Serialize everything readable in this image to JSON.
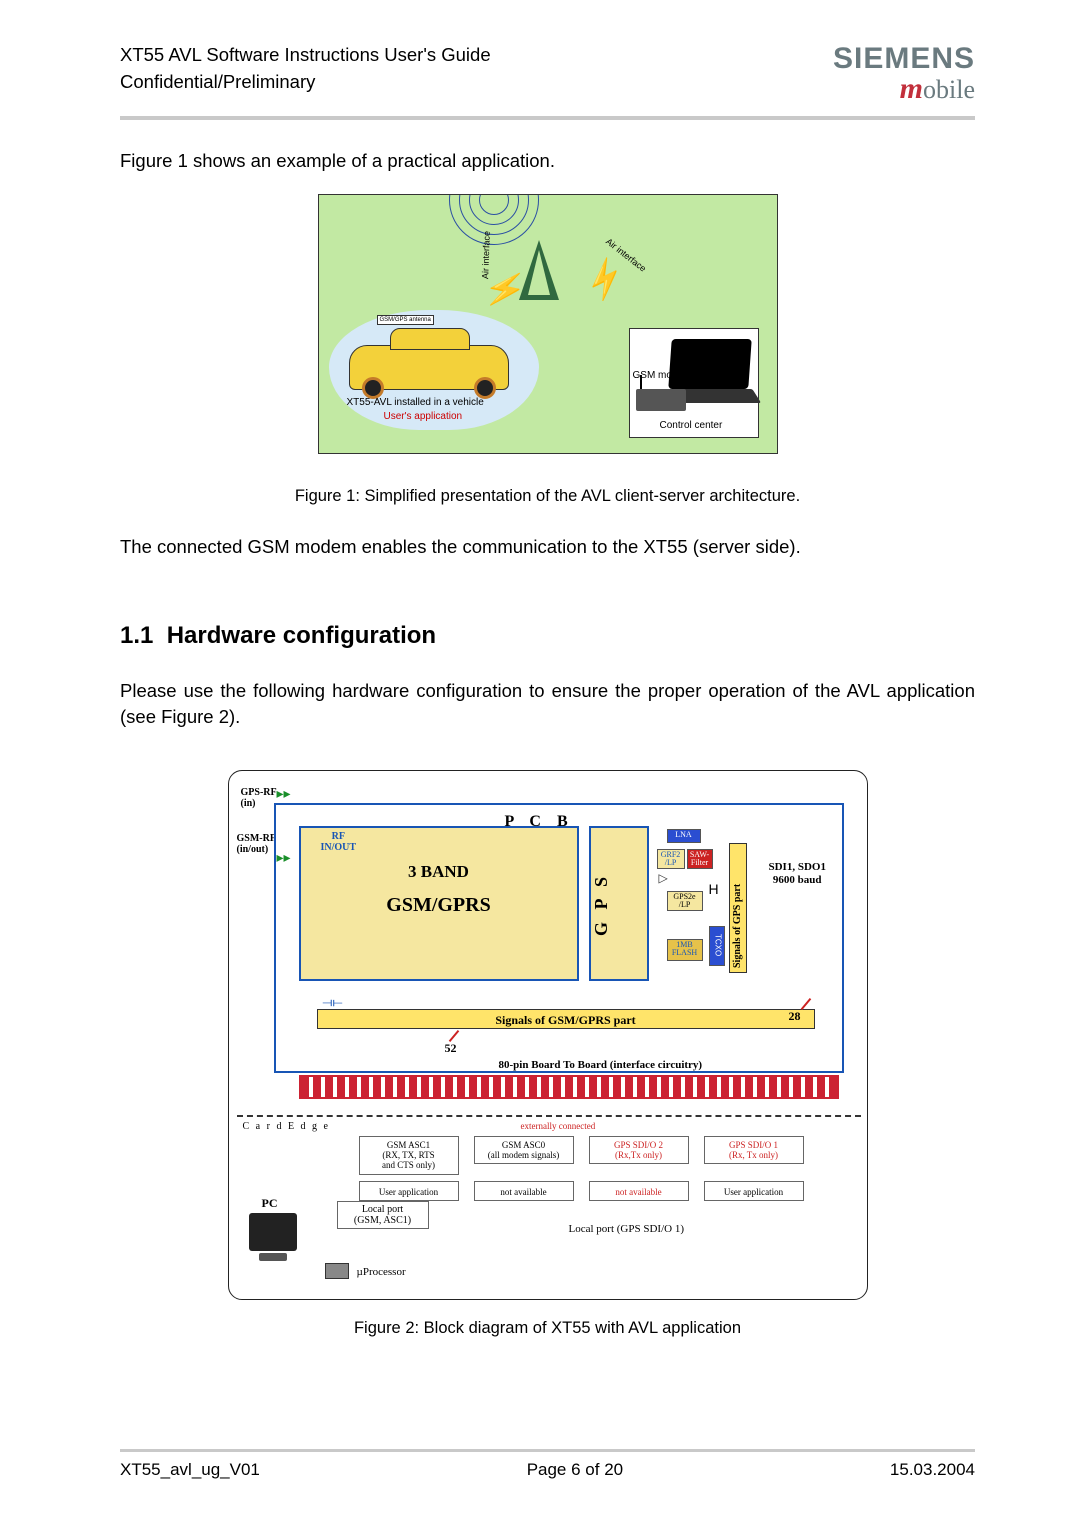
{
  "header": {
    "title_line1": "XT55 AVL Software Instructions User's Guide",
    "title_line2": "Confidential/Preliminary",
    "brand": "SIEMENS",
    "brand_sub_m": "m",
    "brand_sub_rest": "obile"
  },
  "intro_text": "Figure 1 shows an example of a practical application.",
  "figure1": {
    "air_interface": "Air interface",
    "gsm_gps_antenna": "GSM/GPS antenna",
    "vehicle_label": "XT55-AVL installed in a vehicle",
    "user_app": "User's application",
    "gsm_modem": "GSM modem",
    "control_center": "Control center",
    "caption": "Figure 1: Simplified presentation of the AVL client-server architecture."
  },
  "mid_text": "The connected GSM modem enables the communication to the XT55 (server side).",
  "section": {
    "num": "1.1",
    "title": "Hardware configuration"
  },
  "section_text": "Please use the following hardware configuration to ensure the proper operation of the AVL application (see Figure 2).",
  "figure2": {
    "gps_rf": "GPS-RF\n(in)",
    "gsm_rf": "GSM-RF\n(in/out)",
    "pcb": "P  C  B",
    "rf_inout": "RF\nIN/OUT",
    "three_band": "3 BAND",
    "gsm_gprs": "GSM/GPRS",
    "gps_vert": "G P S",
    "lna": "LNA",
    "grf2": "GRF2\n/LP",
    "saw": "SAW-\nFilter",
    "gps2e": "GPS2e\n/LP",
    "flash": "1MB\nFLASH",
    "tcxo": "TCXO",
    "sig_gps": "Signals of GPS part",
    "sdi": "SDI1, SDO1\n9600 baud",
    "sig_gsm": "Signals of GSM/GPRS part",
    "n52": "52",
    "n28": "28",
    "b2b": "80-pin Board To Board (interface circuitry)",
    "card_edge": "C a r d   E d g e",
    "ext_conn": "externally connected",
    "colA1": "GSM ASC1\n(RX, TX, RTS\nand CTS only)",
    "colB1": "GSM ASC0\n(all modem signals)",
    "colC1": "GPS SDI/O 2\n(Rx,Tx only)",
    "colD1": "GPS SDI/O 1\n(Rx, Tx only)",
    "colA2": "User application",
    "colB2": "not available",
    "colC2": "not available",
    "colD2": "User application",
    "pc": "PC",
    "local_port_gsm": "Local port\n(GSM, ASC1)",
    "local_port_gps": "Local port (GPS SDI/O 1)",
    "uproc": "µProcessor",
    "caption": "Figure 2: Block diagram of XT55 with AVL application"
  },
  "footer": {
    "left": "XT55_avl_ug_V01",
    "center": "Page 6 of 20",
    "right": "15.03.2004"
  }
}
